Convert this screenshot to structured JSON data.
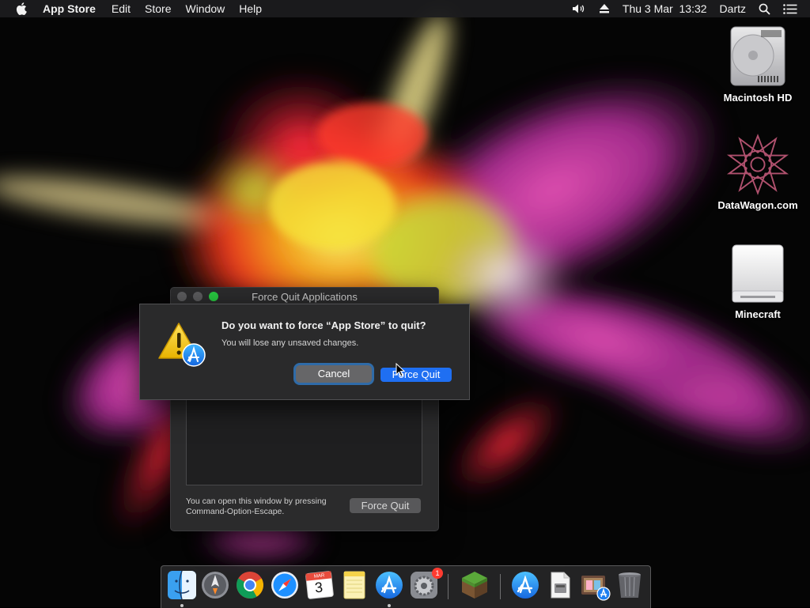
{
  "menubar": {
    "apple_icon": "apple-icon",
    "app_name": "App Store",
    "items": [
      "Edit",
      "Store",
      "Window",
      "Help"
    ],
    "volume_icon": "volume-icon",
    "eject_icon": "eject-icon",
    "datetime": "Thu 3 Mar  13:32",
    "user": "Dartz",
    "search_icon": "spotlight-search-icon",
    "notification_icon": "notification-center-icon"
  },
  "desktop": {
    "icons": [
      {
        "label": "Macintosh HD",
        "icon": "hard-drive-icon"
      },
      {
        "label": "DataWagon.com",
        "icon": "network-share-icon"
      },
      {
        "label": "Minecraft",
        "icon": "external-drive-icon"
      }
    ]
  },
  "force_quit_window": {
    "title": "Force Quit Applications",
    "hint_line1": "You can open this window by pressing",
    "hint_line2": "Command-Option-Escape.",
    "button": "Force Quit"
  },
  "alert": {
    "title": "Do you want to force “App Store” to quit?",
    "message": "You will lose any unsaved changes.",
    "cancel": "Cancel",
    "confirm": "Force Quit",
    "icon": "warning-app-store-icon"
  },
  "dock": {
    "apps": [
      {
        "name": "Finder",
        "icon": "finder-icon",
        "running": true
      },
      {
        "name": "Launchpad",
        "icon": "launchpad-icon",
        "running": false
      },
      {
        "name": "Chrome",
        "icon": "chrome-icon",
        "running": false
      },
      {
        "name": "Safari",
        "icon": "safari-icon",
        "running": false
      },
      {
        "name": "Calendar",
        "icon": "calendar-icon",
        "running": false,
        "month": "MAR",
        "day": "3"
      },
      {
        "name": "Notes",
        "icon": "notes-icon",
        "running": false
      },
      {
        "name": "App Store",
        "icon": "app-store-icon",
        "running": true
      },
      {
        "name": "System Preferences",
        "icon": "system-preferences-icon",
        "running": false,
        "badge": "1"
      },
      {
        "name": "Minecraft",
        "icon": "minecraft-icon",
        "running": false
      },
      {
        "name": "Applications",
        "icon": "applications-folder-icon",
        "running": false
      },
      {
        "name": "Document",
        "icon": "document-icon",
        "running": false
      },
      {
        "name": "Installer",
        "icon": "installer-icon",
        "running": false
      },
      {
        "name": "Trash",
        "icon": "trash-icon",
        "running": false
      }
    ]
  },
  "colors": {
    "accent": "#1f6ff2",
    "focus_ring": "#2f6ba8",
    "window_bg": "#2b2b2c",
    "menubar_bg": "#1c1c1e"
  }
}
